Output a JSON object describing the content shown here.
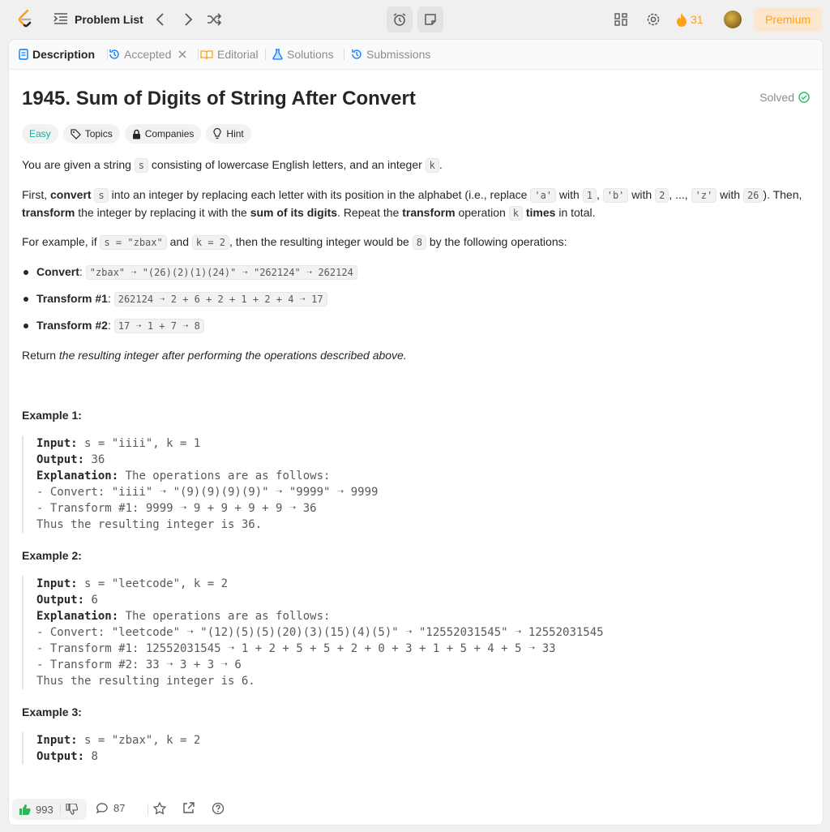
{
  "nav": {
    "problem_list": "Problem List",
    "streak": "31",
    "premium": "Premium"
  },
  "tabs": [
    {
      "label": "Description"
    },
    {
      "label": "Accepted"
    },
    {
      "label": "Editorial"
    },
    {
      "label": "Solutions"
    },
    {
      "label": "Submissions"
    }
  ],
  "problem": {
    "title": "1945. Sum of Digits of String After Convert",
    "status": "Solved",
    "tags": {
      "difficulty": "Easy",
      "topics": "Topics",
      "companies": "Companies",
      "hint": "Hint"
    }
  },
  "text": {
    "p1a": "You are given a string ",
    "p1s": "s",
    "p1b": " consisting of lowercase English letters, and an integer ",
    "p1k": "k",
    "p1c": ".",
    "p2a": "First, ",
    "p2b": "convert",
    "p2c": " ",
    "p2s": "s",
    "p2d": " into an integer by replacing each letter with its position in the alphabet (i.e., replace ",
    "p2a_code": "'a'",
    "p2with1": " with ",
    "p2one": "1",
    "p2comma": ", ",
    "p2b_code": "'b'",
    "p2with2": " with ",
    "p2two": "2",
    "p2dots": ", ..., ",
    "p2z_code": "'z'",
    "p2with3": " with ",
    "p2twentysix": "26",
    "p2e": "). Then,",
    "p3a": "transform",
    "p3b": " the integer by replacing it with the ",
    "p3c": "sum of its digits",
    "p3d": ". Repeat the ",
    "p3e": "transform",
    "p3f": " operation ",
    "p3k": "k",
    "p3g": " times",
    "p3h": " in total.",
    "p4a": "For example, if ",
    "p4s": "s = \"zbax\"",
    "p4b": " and ",
    "p4k": "k = 2",
    "p4c": ", then the resulting integer would be ",
    "p4v": "8",
    "p4d": " by the following operations:",
    "b1label": "Convert",
    "b1code": "\"zbax\" ➝ \"(26)(2)(1)(24)\" ➝ \"262124\" ➝ 262124",
    "b2label": "Transform #1",
    "b2code": "262124 ➝ 2 + 6 + 2 + 1 + 2 + 4 ➝ 17",
    "b3label": "Transform #2",
    "b3code": "17 ➝ 1 + 7 ➝ 8",
    "colon": ": ",
    "ret_a": "Return ",
    "ret_b": "the resulting integer after performing the operations described above."
  },
  "examples": [
    {
      "heading": "Example 1:",
      "input": "s = \"iiii\", k = 1",
      "output": "36",
      "explanation": "The operations are as follows:",
      "lines": [
        "- Convert: \"iiii\" ➝ \"(9)(9)(9)(9)\" ➝ \"9999\" ➝ 9999",
        "- Transform #1: 9999 ➝ 9 + 9 + 9 + 9 ➝ 36",
        "Thus the resulting integer is 36."
      ]
    },
    {
      "heading": "Example 2:",
      "input": "s = \"leetcode\", k = 2",
      "output": "6",
      "explanation": "The operations are as follows:",
      "lines": [
        "- Convert: \"leetcode\" ➝ \"(12)(5)(5)(20)(3)(15)(4)(5)\" ➝ \"12552031545\" ➝ 12552031545",
        "- Transform #1: 12552031545 ➝ 1 + 2 + 5 + 5 + 2 + 0 + 3 + 1 + 5 + 4 + 5 ➝ 33",
        "- Transform #2: 33 ➝ 3 + 3 ➝ 6",
        "Thus the resulting integer is 6."
      ]
    },
    {
      "heading": "Example 3:",
      "input": "s = \"zbax\", k = 2",
      "output": "8"
    }
  ],
  "labels": {
    "input": "Input:",
    "output": "Output:",
    "explanation": "Explanation:"
  },
  "footer": {
    "likes": "993",
    "comments": "87"
  },
  "colors": {
    "accent": "#ffa116",
    "easy": "#00b8a3",
    "solved": "#2cbb5d",
    "like": "#2db55d"
  }
}
